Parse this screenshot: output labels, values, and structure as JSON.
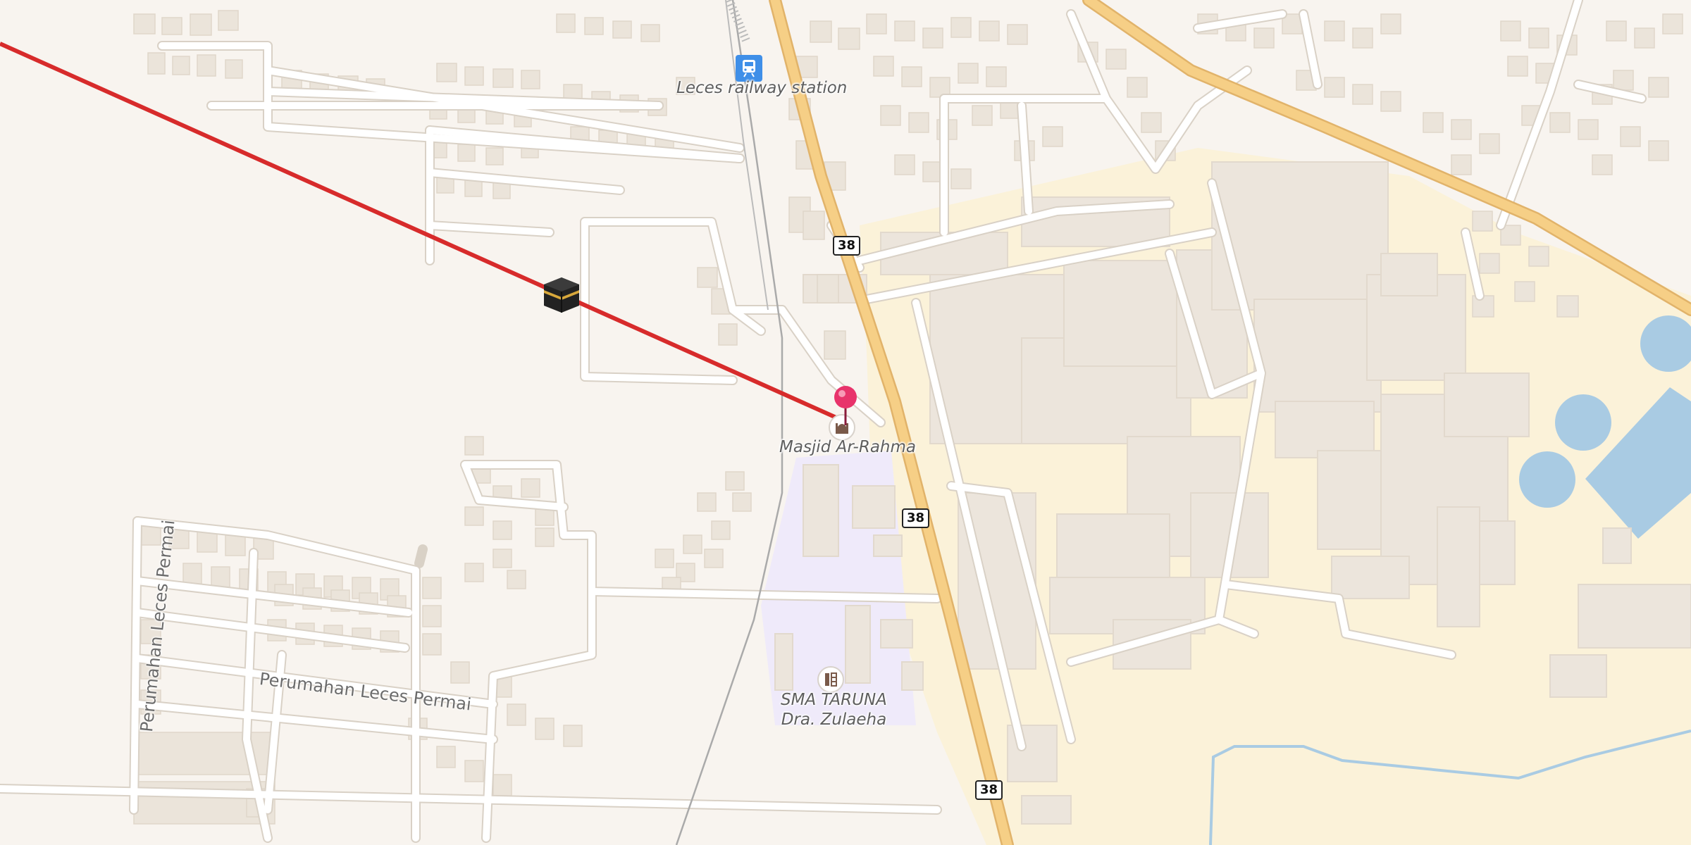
{
  "map": {
    "labels": {
      "station": "Leces railway station",
      "mosque": "Masjid Ar-Rahma",
      "school_line1": "SMA TARUNA",
      "school_line2": "Dra. Zulaeha",
      "street_horizontal": "Perumahan Leces Permai",
      "street_vertical": "Perumahan Leces Permai"
    },
    "road_shields": [
      "38",
      "38",
      "38"
    ],
    "icons": {
      "station": "train-station-icon",
      "mosque": "mosque-icon",
      "school": "school-icon",
      "kaaba": "kaaba-icon",
      "pin": "location-pin-icon"
    },
    "colors": {
      "background": "#f8f4ef",
      "industrial": "#fbf2d9",
      "building": "#ece5dc",
      "major_road": "#f6cf86",
      "road": "#ffffff",
      "qibla_line": "#d72b2b",
      "water": "#a9cbe3",
      "school_area": "#efeafa",
      "pin": "#e8336b",
      "station_icon": "#3f8fe8"
    }
  }
}
